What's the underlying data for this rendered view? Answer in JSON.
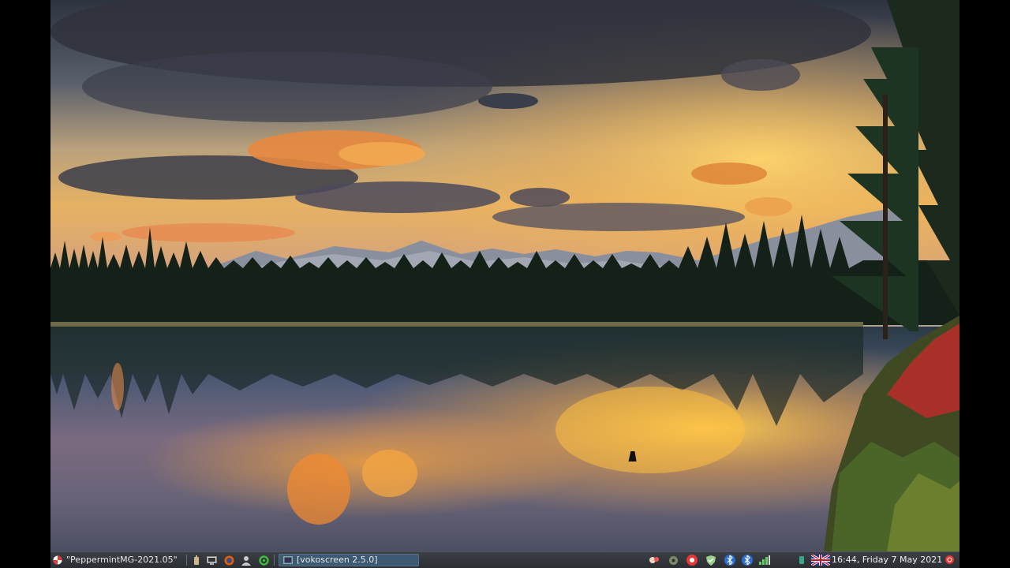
{
  "taskbar": {
    "menu_button_icon": "peppermint-logo-icon",
    "window_title_label": "\"PeppermintMG-2021.05\"",
    "quicklaunch_icons": [
      "battery-icon",
      "terminal-icon",
      "firefox-icon",
      "user-icon",
      "refresh-icon"
    ],
    "task_label": "[vokoscreen 2.5.0]",
    "task_icon": "vokoscreen-icon",
    "tray_icons": [
      "weather-icon",
      "settings-icon",
      "record-icon",
      "shield-icon",
      "bluetooth-icon",
      "bluetooth-icon",
      "network-icon",
      "power-icon"
    ],
    "flag_icon": "uk-flag-icon",
    "clock_text": "16:44, Friday  7 May 2021",
    "power_icon": "power-button-icon"
  },
  "desktop": {
    "wallpaper": "sunset-lake-mountains-wallpaper"
  },
  "colors": {
    "taskbar_bg": "#2b2e33",
    "task_button_bg": "#3d5a73",
    "accent_record": "#e53935"
  }
}
